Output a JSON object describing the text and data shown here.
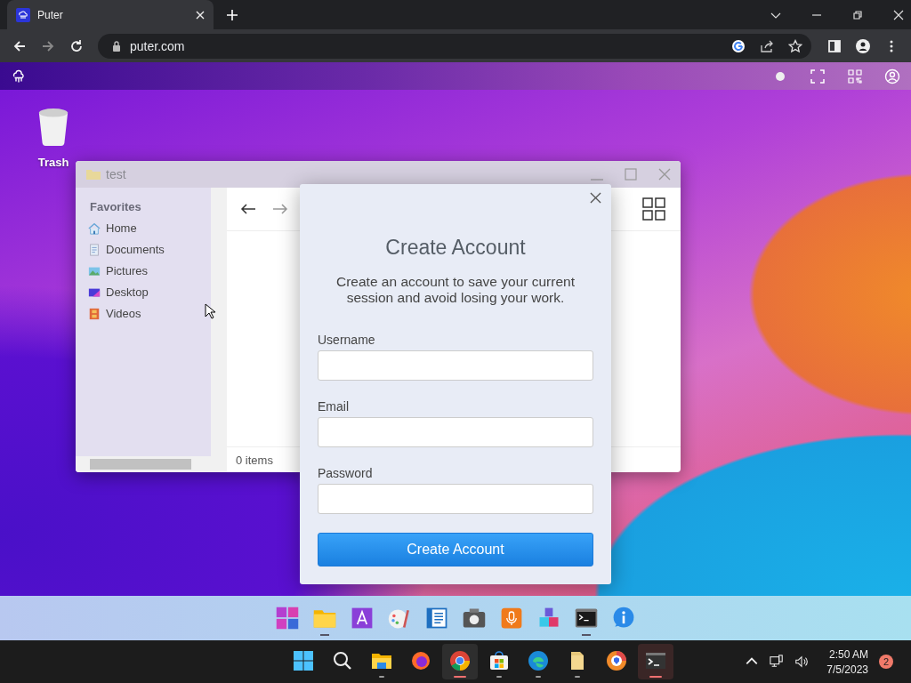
{
  "browser": {
    "tab_title": "Puter",
    "url": "puter.com"
  },
  "desktop_icons": [
    {
      "label": "Trash"
    }
  ],
  "explorer": {
    "title": "test",
    "sidebar_heading": "Favorites",
    "items": [
      {
        "label": "Home",
        "kind": "home"
      },
      {
        "label": "Documents",
        "kind": "documents"
      },
      {
        "label": "Pictures",
        "kind": "pictures"
      },
      {
        "label": "Desktop",
        "kind": "desktop"
      },
      {
        "label": "Videos",
        "kind": "videos"
      }
    ],
    "status": "0 items"
  },
  "dialog": {
    "title": "Create Account",
    "message": "Create an account to save your current session and avoid losing your work.",
    "fields": [
      {
        "label": "Username"
      },
      {
        "label": "Email"
      },
      {
        "label": "Password"
      }
    ],
    "submit": "Create Account"
  },
  "dock": [
    {
      "kind": "apps",
      "running": false
    },
    {
      "kind": "files",
      "running": true
    },
    {
      "kind": "text",
      "running": false
    },
    {
      "kind": "paint",
      "running": false
    },
    {
      "kind": "notes",
      "running": false
    },
    {
      "kind": "camera",
      "running": false
    },
    {
      "kind": "recorder",
      "running": false
    },
    {
      "kind": "cubes",
      "running": false
    },
    {
      "kind": "terminal",
      "running": true
    },
    {
      "kind": "info",
      "running": false
    }
  ],
  "taskbar": [
    {
      "kind": "start",
      "running": false,
      "active": false
    },
    {
      "kind": "search",
      "running": false,
      "active": false
    },
    {
      "kind": "explorer",
      "running": true,
      "active": false
    },
    {
      "kind": "firefox",
      "running": false,
      "active": false
    },
    {
      "kind": "chrome",
      "running": true,
      "active": true
    },
    {
      "kind": "store",
      "running": true,
      "active": false
    },
    {
      "kind": "edge",
      "running": true,
      "active": false
    },
    {
      "kind": "folder",
      "running": true,
      "active": false
    },
    {
      "kind": "browser",
      "running": false,
      "active": false
    },
    {
      "kind": "terminal",
      "running": true,
      "active": true
    }
  ],
  "tray": {
    "time": "2:50 AM",
    "date": "7/5/2023",
    "notifications": "2"
  }
}
